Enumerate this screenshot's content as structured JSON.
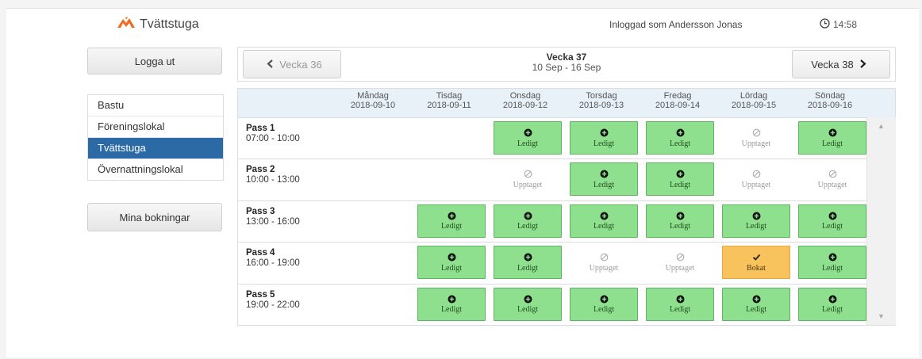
{
  "header": {
    "brand": "Tvättstuga",
    "user_text": "Inloggad som Andersson Jonas",
    "time": "14:58"
  },
  "sidebar": {
    "logout_label": "Logga ut",
    "categories": [
      "Bastu",
      "Föreningslokal",
      "Tvättstuga",
      "Övernattningslokal"
    ],
    "active_category": "Tvättstuga",
    "my_bookings_label": "Mina bokningar"
  },
  "week": {
    "prev_label": "Vecka 36",
    "title": "Vecka 37",
    "range": "10 Sep - 16 Sep",
    "next_label": "Vecka 38"
  },
  "days": [
    {
      "name": "Måndag",
      "date": "2018-09-10"
    },
    {
      "name": "Tisdag",
      "date": "2018-09-11"
    },
    {
      "name": "Onsdag",
      "date": "2018-09-12"
    },
    {
      "name": "Torsdag",
      "date": "2018-09-13"
    },
    {
      "name": "Fredag",
      "date": "2018-09-14"
    },
    {
      "name": "Lördag",
      "date": "2018-09-15"
    },
    {
      "name": "Söndag",
      "date": "2018-09-16"
    }
  ],
  "status_labels": {
    "free": "Ledigt",
    "taken": "Upptaget",
    "booked": "Bokat"
  },
  "passes": [
    {
      "name": "Pass 1",
      "time": "07:00 - 10:00",
      "slots": [
        "none",
        "none",
        "free",
        "free",
        "free",
        "taken",
        "free"
      ]
    },
    {
      "name": "Pass 2",
      "time": "10:00 - 13:00",
      "slots": [
        "none",
        "none",
        "taken",
        "free",
        "free",
        "taken",
        "taken"
      ]
    },
    {
      "name": "Pass 3",
      "time": "13:00 - 16:00",
      "slots": [
        "none",
        "free",
        "free",
        "free",
        "free",
        "free",
        "free"
      ]
    },
    {
      "name": "Pass 4",
      "time": "16:00 - 19:00",
      "slots": [
        "none",
        "free",
        "free",
        "taken",
        "taken",
        "booked",
        "free"
      ]
    },
    {
      "name": "Pass 5",
      "time": "19:00 - 22:00",
      "slots": [
        "none",
        "free",
        "free",
        "free",
        "free",
        "free",
        "free"
      ]
    }
  ],
  "colors": {
    "free": "#8ee08e",
    "booked": "#f8c25c",
    "active_nav": "#2c6aa6",
    "brand": "#f26a21"
  },
  "icons": {
    "brand": "logo-icon",
    "clock": "clock-icon",
    "prev": "chevron-left-icon",
    "next": "chevron-right-icon",
    "free": "plus-circle-icon",
    "taken": "ban-icon",
    "booked": "check-icon"
  }
}
